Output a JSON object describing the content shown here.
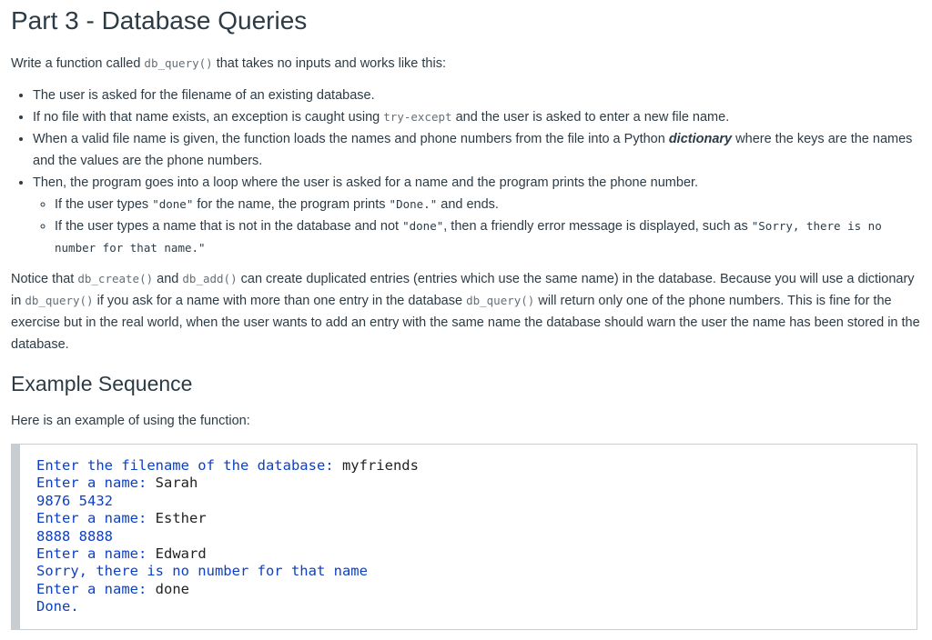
{
  "title": "Part 3 - Database Queries",
  "intro": {
    "before": "Write a function called ",
    "code": "db_query()",
    "after": " that takes no inputs and works like this:"
  },
  "bullets": {
    "b1": "The user is asked for the filename of an existing database.",
    "b2_before": "If no file with that name exists, an exception is caught using ",
    "b2_code": "try-except",
    "b2_after": " and the user is asked to enter a new file name.",
    "b3_before": "When a valid file name is given, the function loads the names and phone numbers from the file into a Python ",
    "b3_bold": "dictionary",
    "b3_after": " where the keys are the names and the values are the phone numbers.",
    "b4": "Then, the program goes into a loop where the user is asked for a name and the program prints the phone number.",
    "s1_before": "If the user types ",
    "s1_code1": "\"done\"",
    "s1_mid": " for the name, the program prints ",
    "s1_code2": "\"Done.\"",
    "s1_after": " and ends.",
    "s2_before": "If the user types a name that is not in the database and not ",
    "s2_code1": "\"done\"",
    "s2_mid": ", then a friendly error message is displayed, such as ",
    "s2_code2": "\"Sorry, there is no number for that name.\""
  },
  "notice": {
    "t1": "Notice that ",
    "c1": "db_create()",
    "t2": " and ",
    "c2": "db_add()",
    "t3": " can create duplicated entries (entries which use the same name) in the database. Because you will use a dictionary in ",
    "c3": "db_query()",
    "t4": " if you ask for a name with more than one entry in the database ",
    "c4": "db_query()",
    "t5": " will return only one of the phone numbers. This is fine for the exercise but in the real world, when the user wants to add an entry with the same name the database should warn the user the name has been stored in the database."
  },
  "example_heading": "Example Sequence",
  "example_intro": "Here is an example of using the function:",
  "example": {
    "l1_prompt": "Enter the filename of the database: ",
    "l1_input": "myfriends",
    "l2_prompt": "Enter a name: ",
    "l2_input": "Sarah",
    "l3_output": "9876 5432",
    "l4_prompt": "Enter a name: ",
    "l4_input": "Esther",
    "l5_output": "8888 8888",
    "l6_prompt": "Enter a name: ",
    "l6_input": "Edward",
    "l7_output": "Sorry, there is no number for that name",
    "l8_prompt": "Enter a name: ",
    "l8_input": "done",
    "l9_output": "Done."
  }
}
